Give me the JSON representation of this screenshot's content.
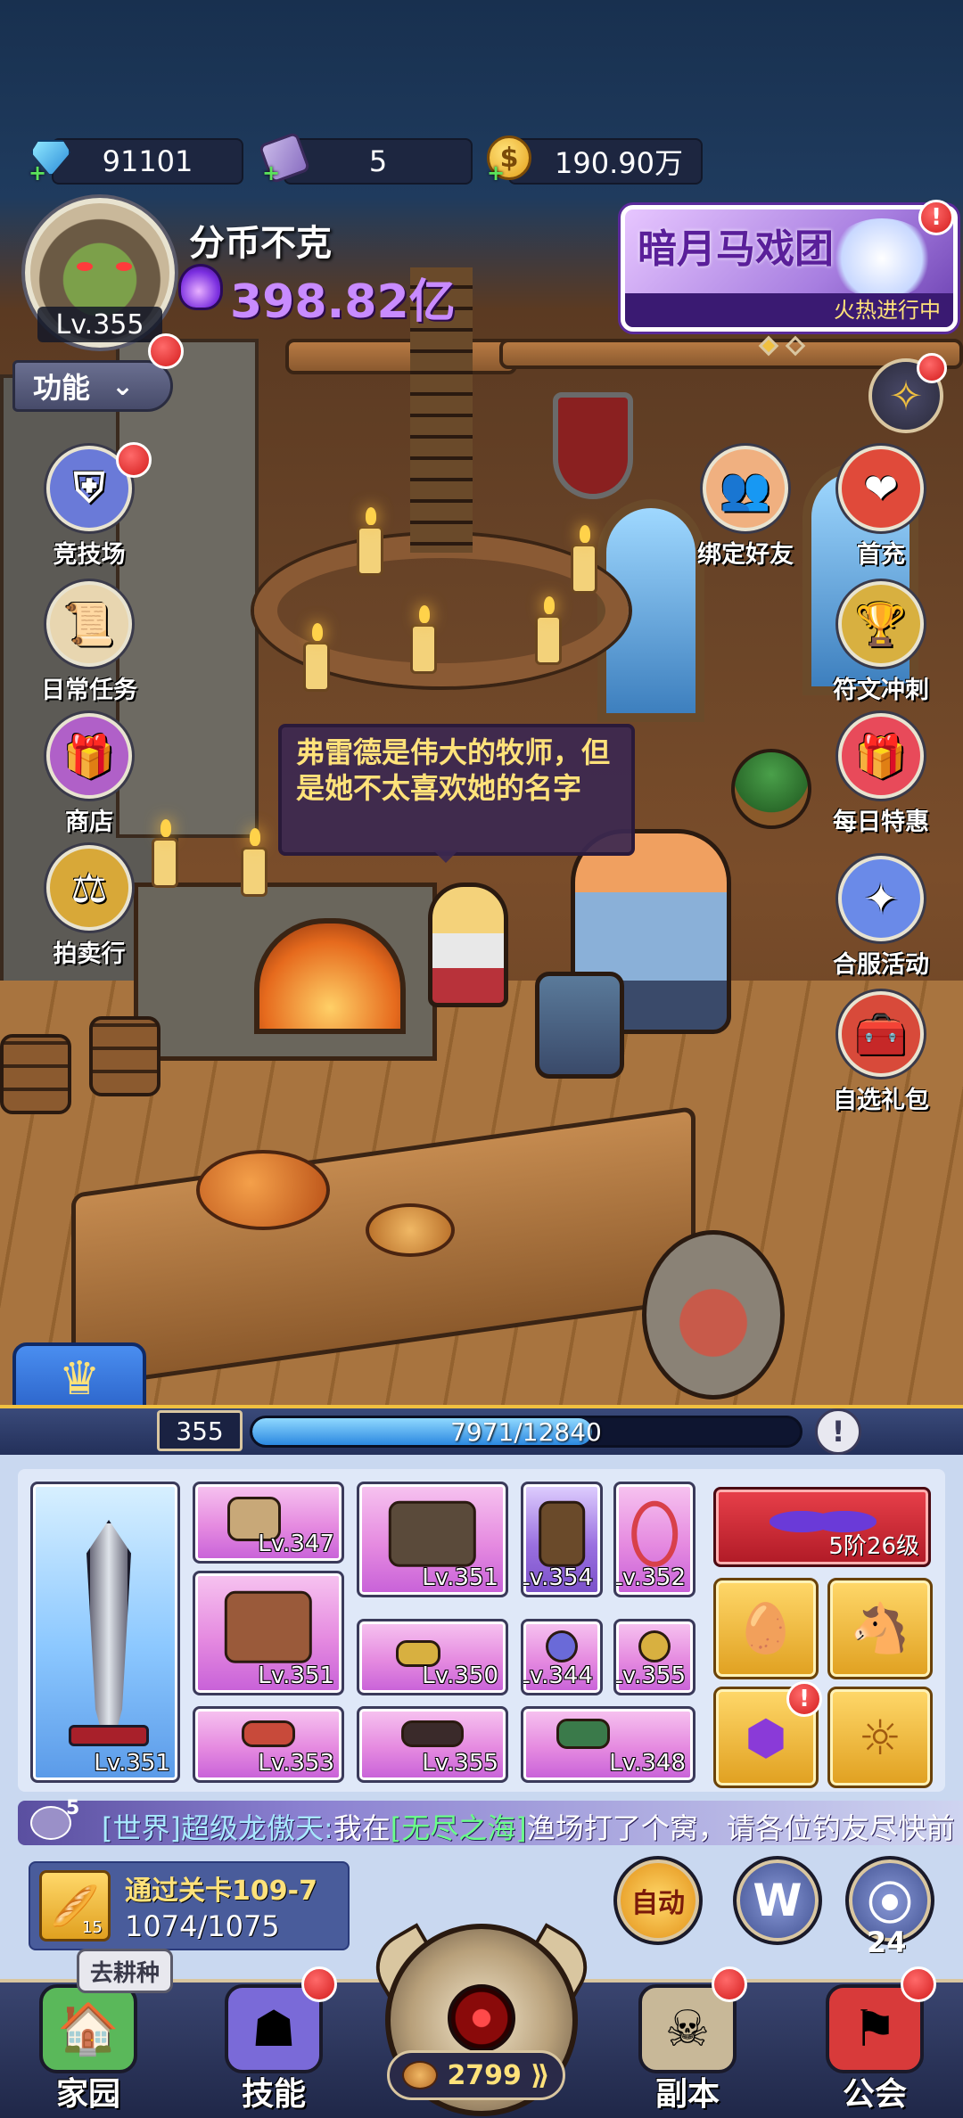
{
  "resources": {
    "diamonds": "91101",
    "scrolls": "5",
    "gold": "190.90万",
    "diamond_icon": "diamond-icon",
    "scroll_icon": "summon-scroll-icon",
    "gold_icon": "gold-coin-icon",
    "coin_symbol": "$",
    "plus_symbol": "+"
  },
  "player": {
    "name": "分币不克",
    "level": "Lv.355",
    "power": "398.82亿",
    "avatar_icon": "orc-avatar-icon"
  },
  "event_banner": {
    "title": "暗月马戏团",
    "subtitle": "火热进行中",
    "pages": 2,
    "active_page": 0
  },
  "badge_excl": "!",
  "function_menu": {
    "label": "功能",
    "chevron": "⌄"
  },
  "left_menu": [
    {
      "label": "竞技场",
      "icon": "arena-shield-icon",
      "glyph": "⛨",
      "color": "#6a7ad8"
    },
    {
      "label": "日常任务",
      "icon": "daily-quest-scroll-icon",
      "glyph": "📜",
      "color": "#e8d6b0"
    },
    {
      "label": "商店",
      "icon": "shop-chest-icon",
      "glyph": "🎁",
      "color": "#b060c8"
    },
    {
      "label": "拍卖行",
      "icon": "auction-scale-icon",
      "glyph": "⚖",
      "color": "#d8a838"
    }
  ],
  "right_menu": [
    {
      "label": "绑定好友",
      "icon": "bind-friend-icon",
      "glyph": "👥",
      "color": "#f0b080"
    },
    {
      "label": "首充",
      "icon": "first-recharge-icon",
      "glyph": "❤",
      "color": "#e04a3a"
    },
    {
      "label": "符文冲刺",
      "icon": "rune-trophy-icon",
      "glyph": "🏆",
      "color": "#d8b040"
    },
    {
      "label": "每日特惠",
      "icon": "daily-deal-gift-icon",
      "glyph": "🎁",
      "color": "#e84a5a"
    },
    {
      "label": "合服活动",
      "icon": "server-merge-puzzle-icon",
      "glyph": "✦",
      "color": "#6a8ae8"
    },
    {
      "label": "自选礼包",
      "icon": "selectable-pack-chest-icon",
      "glyph": "🧰",
      "color": "#d84a3a"
    }
  ],
  "compass_icon": "compass-star-icon",
  "compass_glyph": "✧",
  "dialog": {
    "text": "弗雷德是伟大的牧师，但是她不太喜欢她的名字"
  },
  "experience": {
    "level": "355",
    "current": 7971,
    "max": 12840,
    "text": "7971/12840",
    "info_symbol": "!"
  },
  "collapse_icon": "collapse-crown-icon",
  "collapse_glyph": "♛",
  "equipment": {
    "weapon": {
      "level": "Lv.351",
      "icon": "greatsword-icon"
    },
    "helmet": {
      "level": "Lv.347",
      "icon": "horned-helmet-icon"
    },
    "hood": {
      "level": "Lv.351",
      "icon": "hood-icon"
    },
    "gloves": {
      "level": "Lv.354",
      "icon": "gauntlets-icon"
    },
    "necklace": {
      "level": "Lv.352",
      "icon": "necklace-icon"
    },
    "chest": {
      "level": "Lv.351",
      "icon": "chest-armor-icon"
    },
    "bracelet": {
      "level": "Lv.350",
      "icon": "bracelet-icon"
    },
    "ring1": {
      "level": "Lv.344",
      "icon": "ring-icon"
    },
    "ring2": {
      "level": "Lv.355",
      "icon": "ring-icon"
    },
    "belt": {
      "level": "Lv.353",
      "icon": "belt-icon"
    },
    "pants": {
      "level": "Lv.355",
      "icon": "pants-icon"
    },
    "boots": {
      "level": "Lv.348",
      "icon": "boots-icon"
    },
    "wings": {
      "text": "5阶26级",
      "icon": "butterfly-wings-icon"
    },
    "pet_egg_icon": "pet-egg-icon",
    "pet_egg_glyph": "🥚",
    "mount_icon": "mount-horse-icon",
    "mount_glyph": "🐴",
    "gem_icon": "rainbow-gem-icon",
    "gem_glyph": "⬢",
    "rune_icon": "sun-rune-icon",
    "rune_glyph": "☼"
  },
  "chat": {
    "count": "5",
    "channel": "[世界]",
    "sender": "超级龙傲天:",
    "text_before": "我在",
    "location": "[无尽之海]",
    "text_after": "渔场打了个窝，请各位钓友尽快前",
    "icon": "chat-bubble-icon"
  },
  "quest": {
    "title": "通过关卡109-7",
    "progress": "1074/1075",
    "item_count": "15",
    "icon": "bread-icon",
    "glyph": "🥖",
    "farm_label": "去耕种"
  },
  "actions": {
    "auto_label": "自动",
    "world_label": "W",
    "portal_label": "⦿",
    "portal_count": "24"
  },
  "nav": [
    {
      "label": "家园",
      "icon": "home-house-icon",
      "glyph": "🏠",
      "color": "#5ab85a",
      "badge": false
    },
    {
      "label": "技能",
      "icon": "skill-hood-icon",
      "glyph": "☗",
      "color": "#7a6ad8",
      "badge": true
    },
    {
      "label": "副本",
      "icon": "dungeon-skull-icon",
      "glyph": "☠",
      "color": "#c8b898",
      "badge": true
    },
    {
      "label": "公会",
      "icon": "guild-banner-icon",
      "glyph": "⚑",
      "color": "#d83a3a",
      "badge": true
    }
  ],
  "stamina": {
    "value": "2799",
    "icon": "stamina-bread-icon",
    "add_symbol": "⟫"
  },
  "center_button_icon": "battle-eye-icon",
  "colors": {
    "accent_gold": "#f0c040",
    "power_purple": "#c88bff",
    "badge_red": "#d31c1c",
    "xp_blue": "#2b88e0"
  }
}
